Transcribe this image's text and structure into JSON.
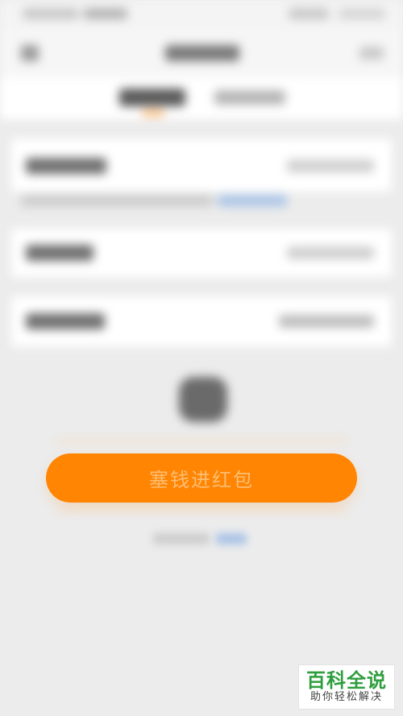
{
  "submit": {
    "label": "塞钱进红包",
    "button_color": "#ff8503",
    "text_color": "#ffbe73"
  },
  "tabs": {
    "active_indicator_color": "#ff9a2e"
  },
  "footer": {
    "link_color": "#a9c3e6"
  },
  "watermark": {
    "title": "百科全说",
    "subtitle": "助你轻松解决",
    "title_color": "#2f9e3e"
  }
}
